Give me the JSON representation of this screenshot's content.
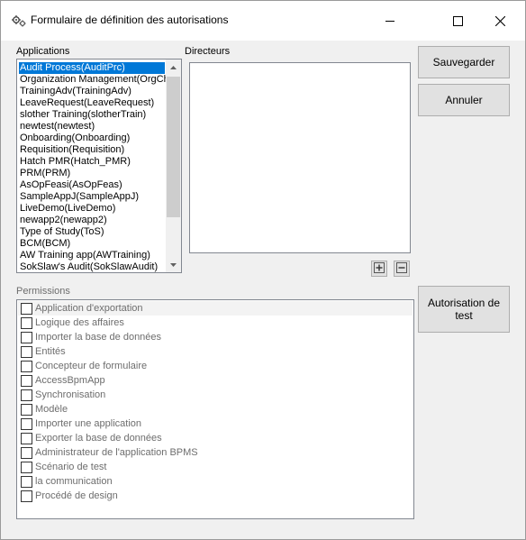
{
  "window": {
    "title": "Formulaire de définition des autorisations",
    "icon": "gears-icon"
  },
  "controls": {
    "minimize": "minimize-icon",
    "maximize": "maximize-icon",
    "close": "close-icon"
  },
  "applications": {
    "label": "Applications",
    "selected_index": 0,
    "items": [
      "Audit Process(AuditPrc)",
      "Organization Management(OrgCh",
      "TrainingAdv(TrainingAdv)",
      "LeaveRequest(LeaveRequest)",
      "slother Training(slotherTrain)",
      "newtest(newtest)",
      "Onboarding(Onboarding)",
      "Requisition(Requisition)",
      "Hatch PMR(Hatch_PMR)",
      "PRM(PRM)",
      "AsOpFeasi(AsOpFeas)",
      "SampleAppJ(SampleAppJ)",
      "LiveDemo(LiveDemo)",
      "newapp2(newapp2)",
      "Type of Study(ToS)",
      "BCM(BCM)",
      "AW Training app(AWTraining)",
      "SokSlaw's Audit(SokSlawAudit)"
    ]
  },
  "directors": {
    "label": "Directeurs",
    "add_icon": "plus-box-icon",
    "remove_icon": "minus-box-icon"
  },
  "buttons": {
    "save": "Sauvegarder",
    "cancel": "Annuler",
    "test_line1": "Autorisation de",
    "test_line2": "test"
  },
  "permissions": {
    "label": "Permissions",
    "items": [
      {
        "label": "Application d'exportation",
        "checked": false
      },
      {
        "label": "Logique des affaires",
        "checked": false
      },
      {
        "label": "Importer la base de données",
        "checked": false
      },
      {
        "label": "Entités",
        "checked": false
      },
      {
        "label": "Concepteur de formulaire",
        "checked": false
      },
      {
        "label": "AccessBpmApp",
        "checked": false
      },
      {
        "label": "Synchronisation",
        "checked": false
      },
      {
        "label": "Modèle",
        "checked": false
      },
      {
        "label": "Importer une application",
        "checked": false
      },
      {
        "label": "Exporter la base de données",
        "checked": false
      },
      {
        "label": "Administrateur de l'application BPMS",
        "checked": false
      },
      {
        "label": "Scénario de test",
        "checked": false
      },
      {
        "label": "la communication",
        "checked": false
      },
      {
        "label": "Procédé de design",
        "checked": false
      }
    ]
  }
}
